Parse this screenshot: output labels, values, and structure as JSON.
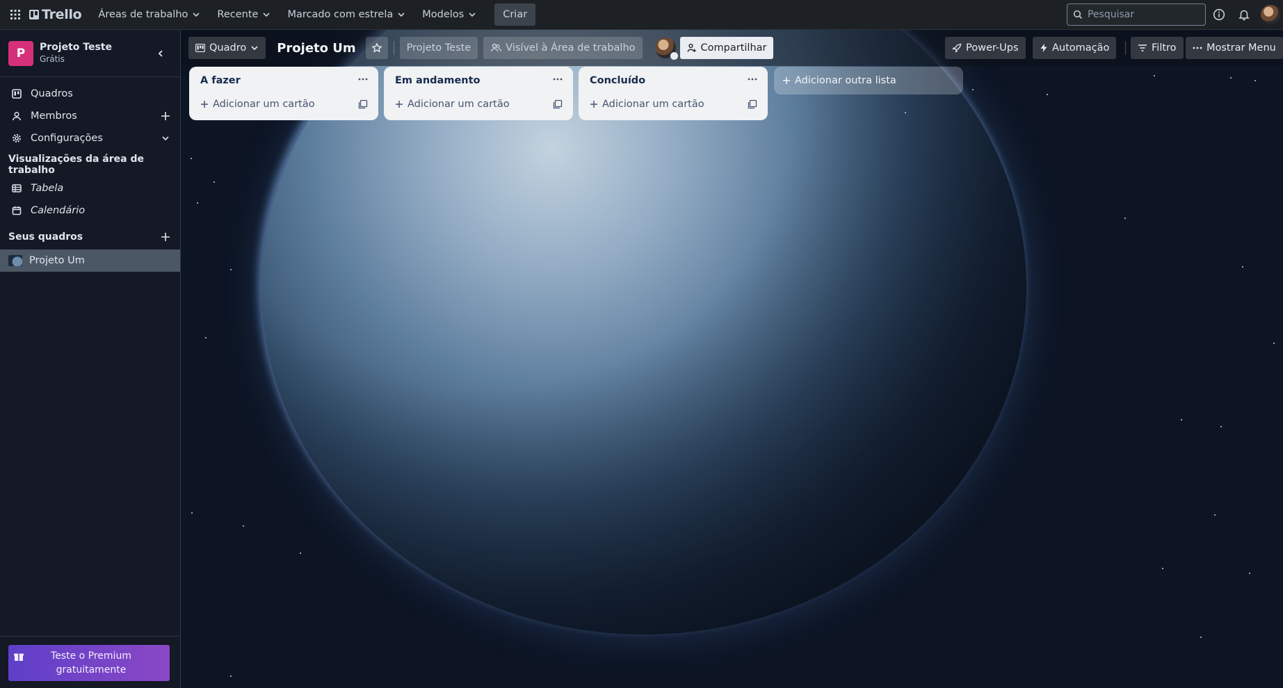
{
  "topnav": {
    "logo_text": "Trello",
    "menus": [
      {
        "label": "Áreas de trabalho"
      },
      {
        "label": "Recente"
      },
      {
        "label": "Marcado com estrela"
      },
      {
        "label": "Modelos"
      }
    ],
    "create_label": "Criar",
    "search_placeholder": "Pesquisar"
  },
  "sidebar": {
    "workspace_initial": "P",
    "workspace_name": "Projeto Teste",
    "workspace_plan": "Grátis",
    "items": [
      {
        "label": "Quadros",
        "icon": "board-icon"
      },
      {
        "label": "Membros",
        "icon": "person-icon"
      },
      {
        "label": "Configurações",
        "icon": "gear-icon"
      }
    ],
    "views_heading": "Visualizações da área de trabalho",
    "views": [
      {
        "label": "Tabela",
        "icon": "table-icon"
      },
      {
        "label": "Calendário",
        "icon": "calendar-icon"
      }
    ],
    "boards_heading": "Seus quadros",
    "boards": [
      {
        "label": "Projeto Um"
      }
    ],
    "premium_label": "Teste o Premium gratuitamente"
  },
  "boardbar": {
    "view_label": "Quadro",
    "board_title": "Projeto Um",
    "workspace_label": "Projeto Teste",
    "visibility_label": "Visível à Área de trabalho",
    "share_label": "Compartilhar",
    "powerups_label": "Power-Ups",
    "automation_label": "Automação",
    "filter_label": "Filtro",
    "menu_label": "Mostrar Menu"
  },
  "lists": [
    {
      "title": "A fazer",
      "add_card_label": "Adicionar um cartão"
    },
    {
      "title": "Em andamento",
      "add_card_label": "Adicionar um cartão"
    },
    {
      "title": "Concluído",
      "add_card_label": "Adicionar um cartão"
    }
  ],
  "add_list_label": "Adicionar outra lista",
  "colors": {
    "nav_bg": "#1d2125",
    "workspace_avatar": "#d6307a",
    "premium_gradient_start": "#5e3fc8",
    "premium_gradient_end": "#8a48c6",
    "list_bg": "#f1f2f4"
  }
}
